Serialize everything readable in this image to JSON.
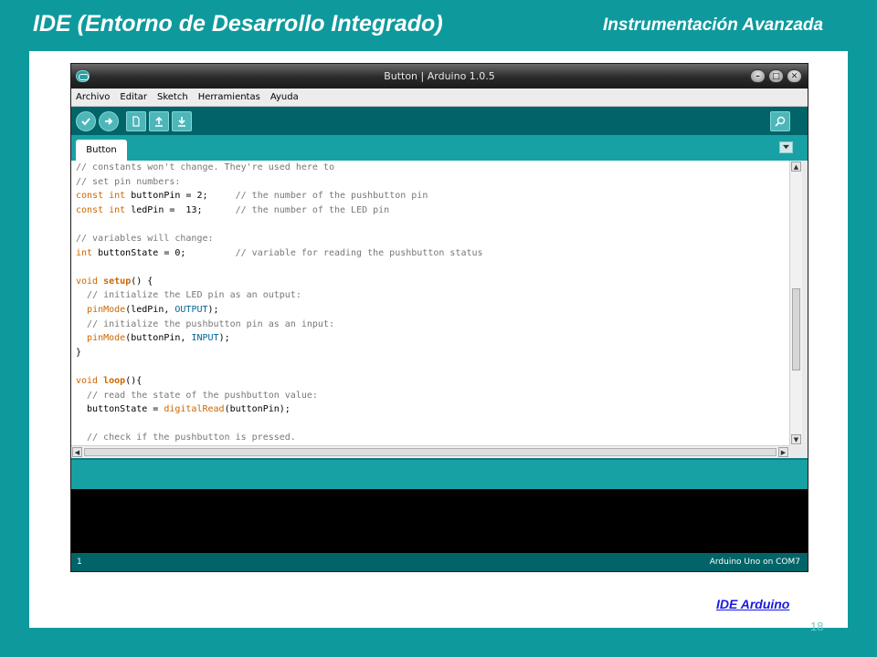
{
  "slide": {
    "title": "IDE (Entorno de Desarrollo Integrado)",
    "subtitle": "Instrumentación Avanzada",
    "link": "IDE Arduino",
    "page_number": "18"
  },
  "window": {
    "title": "Button | Arduino 1.0.5",
    "minimize_glyph": "–",
    "maximize_glyph": "□",
    "close_glyph": "✕"
  },
  "menu": [
    "Archivo",
    "Editar",
    "Sketch",
    "Herramientas",
    "Ayuda"
  ],
  "toolbar": {
    "icons": [
      "verify-icon",
      "upload-icon",
      "new-icon",
      "open-icon",
      "save-icon",
      "serial-monitor-icon"
    ]
  },
  "tabs": {
    "active": "Button"
  },
  "code": [
    [
      {
        "t": "// constants won't change. They're used here to",
        "c": "cmt"
      }
    ],
    [
      {
        "t": "// set pin numbers:",
        "c": "cmt"
      }
    ],
    [
      {
        "t": "const",
        "c": "type"
      },
      {
        "t": " "
      },
      {
        "t": "int",
        "c": "type"
      },
      {
        "t": " buttonPin = 2;     "
      },
      {
        "t": "// the number of the pushbutton pin",
        "c": "cmt"
      }
    ],
    [
      {
        "t": "const",
        "c": "type"
      },
      {
        "t": " "
      },
      {
        "t": "int",
        "c": "type"
      },
      {
        "t": " ledPin =  13;      "
      },
      {
        "t": "// the number of the LED pin",
        "c": "cmt"
      }
    ],
    [
      {
        "t": ""
      }
    ],
    [
      {
        "t": "// variables will change:",
        "c": "cmt"
      }
    ],
    [
      {
        "t": "int",
        "c": "type"
      },
      {
        "t": " buttonState = 0;         "
      },
      {
        "t": "// variable for reading the pushbutton status",
        "c": "cmt"
      }
    ],
    [
      {
        "t": ""
      }
    ],
    [
      {
        "t": "void",
        "c": "type"
      },
      {
        "t": " "
      },
      {
        "t": "setup",
        "c": "fn"
      },
      {
        "t": "() {"
      }
    ],
    [
      {
        "t": "  "
      },
      {
        "t": "// initialize the LED pin as an output:",
        "c": "cmt"
      }
    ],
    [
      {
        "t": "  "
      },
      {
        "t": "pinMode",
        "c": "call"
      },
      {
        "t": "(ledPin, "
      },
      {
        "t": "OUTPUT",
        "c": "const"
      },
      {
        "t": ");"
      }
    ],
    [
      {
        "t": "  "
      },
      {
        "t": "// initialize the pushbutton pin as an input:",
        "c": "cmt"
      }
    ],
    [
      {
        "t": "  "
      },
      {
        "t": "pinMode",
        "c": "call"
      },
      {
        "t": "(buttonPin, "
      },
      {
        "t": "INPUT",
        "c": "const"
      },
      {
        "t": ");"
      }
    ],
    [
      {
        "t": "}"
      }
    ],
    [
      {
        "t": ""
      }
    ],
    [
      {
        "t": "void",
        "c": "type"
      },
      {
        "t": " "
      },
      {
        "t": "loop",
        "c": "fn"
      },
      {
        "t": "(){"
      }
    ],
    [
      {
        "t": "  "
      },
      {
        "t": "// read the state of the pushbutton value:",
        "c": "cmt"
      }
    ],
    [
      {
        "t": "  buttonState = "
      },
      {
        "t": "digitalRead",
        "c": "call"
      },
      {
        "t": "(buttonPin);"
      }
    ],
    [
      {
        "t": ""
      }
    ],
    [
      {
        "t": "  "
      },
      {
        "t": "// check if the pushbutton is pressed.",
        "c": "cmt"
      }
    ]
  ],
  "scroll": {
    "up": "▲",
    "down": "▼",
    "left": "◀",
    "right": "▶"
  },
  "status": {
    "line": "1",
    "board": "Arduino Uno on COM7"
  },
  "colors": {
    "teal_background": "#0e9a9d",
    "toolbar": "#006468",
    "tab_bar": "#17a1a5",
    "keyword": "#cc6600",
    "constant": "#006699",
    "comment": "#777777"
  }
}
